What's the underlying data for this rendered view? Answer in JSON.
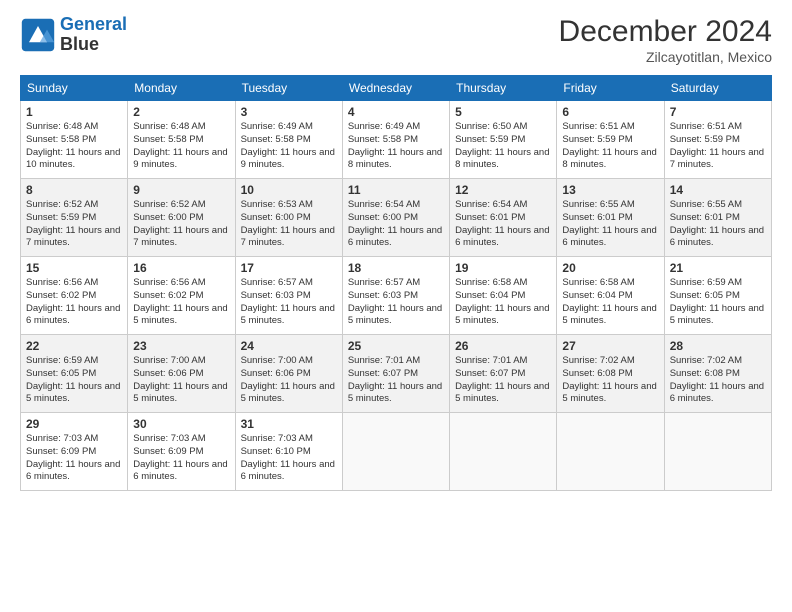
{
  "header": {
    "logo_line1": "General",
    "logo_line2": "Blue",
    "title": "December 2024",
    "subtitle": "Zilcayotitlan, Mexico"
  },
  "weekdays": [
    "Sunday",
    "Monday",
    "Tuesday",
    "Wednesday",
    "Thursday",
    "Friday",
    "Saturday"
  ],
  "weeks": [
    [
      {
        "day": "1",
        "sunrise": "6:48 AM",
        "sunset": "5:58 PM",
        "daylight": "11 hours and 10 minutes."
      },
      {
        "day": "2",
        "sunrise": "6:48 AM",
        "sunset": "5:58 PM",
        "daylight": "11 hours and 9 minutes."
      },
      {
        "day": "3",
        "sunrise": "6:49 AM",
        "sunset": "5:58 PM",
        "daylight": "11 hours and 9 minutes."
      },
      {
        "day": "4",
        "sunrise": "6:49 AM",
        "sunset": "5:58 PM",
        "daylight": "11 hours and 8 minutes."
      },
      {
        "day": "5",
        "sunrise": "6:50 AM",
        "sunset": "5:59 PM",
        "daylight": "11 hours and 8 minutes."
      },
      {
        "day": "6",
        "sunrise": "6:51 AM",
        "sunset": "5:59 PM",
        "daylight": "11 hours and 8 minutes."
      },
      {
        "day": "7",
        "sunrise": "6:51 AM",
        "sunset": "5:59 PM",
        "daylight": "11 hours and 7 minutes."
      }
    ],
    [
      {
        "day": "8",
        "sunrise": "6:52 AM",
        "sunset": "5:59 PM",
        "daylight": "11 hours and 7 minutes."
      },
      {
        "day": "9",
        "sunrise": "6:52 AM",
        "sunset": "6:00 PM",
        "daylight": "11 hours and 7 minutes."
      },
      {
        "day": "10",
        "sunrise": "6:53 AM",
        "sunset": "6:00 PM",
        "daylight": "11 hours and 7 minutes."
      },
      {
        "day": "11",
        "sunrise": "6:54 AM",
        "sunset": "6:00 PM",
        "daylight": "11 hours and 6 minutes."
      },
      {
        "day": "12",
        "sunrise": "6:54 AM",
        "sunset": "6:01 PM",
        "daylight": "11 hours and 6 minutes."
      },
      {
        "day": "13",
        "sunrise": "6:55 AM",
        "sunset": "6:01 PM",
        "daylight": "11 hours and 6 minutes."
      },
      {
        "day": "14",
        "sunrise": "6:55 AM",
        "sunset": "6:01 PM",
        "daylight": "11 hours and 6 minutes."
      }
    ],
    [
      {
        "day": "15",
        "sunrise": "6:56 AM",
        "sunset": "6:02 PM",
        "daylight": "11 hours and 6 minutes."
      },
      {
        "day": "16",
        "sunrise": "6:56 AM",
        "sunset": "6:02 PM",
        "daylight": "11 hours and 5 minutes."
      },
      {
        "day": "17",
        "sunrise": "6:57 AM",
        "sunset": "6:03 PM",
        "daylight": "11 hours and 5 minutes."
      },
      {
        "day": "18",
        "sunrise": "6:57 AM",
        "sunset": "6:03 PM",
        "daylight": "11 hours and 5 minutes."
      },
      {
        "day": "19",
        "sunrise": "6:58 AM",
        "sunset": "6:04 PM",
        "daylight": "11 hours and 5 minutes."
      },
      {
        "day": "20",
        "sunrise": "6:58 AM",
        "sunset": "6:04 PM",
        "daylight": "11 hours and 5 minutes."
      },
      {
        "day": "21",
        "sunrise": "6:59 AM",
        "sunset": "6:05 PM",
        "daylight": "11 hours and 5 minutes."
      }
    ],
    [
      {
        "day": "22",
        "sunrise": "6:59 AM",
        "sunset": "6:05 PM",
        "daylight": "11 hours and 5 minutes."
      },
      {
        "day": "23",
        "sunrise": "7:00 AM",
        "sunset": "6:06 PM",
        "daylight": "11 hours and 5 minutes."
      },
      {
        "day": "24",
        "sunrise": "7:00 AM",
        "sunset": "6:06 PM",
        "daylight": "11 hours and 5 minutes."
      },
      {
        "day": "25",
        "sunrise": "7:01 AM",
        "sunset": "6:07 PM",
        "daylight": "11 hours and 5 minutes."
      },
      {
        "day": "26",
        "sunrise": "7:01 AM",
        "sunset": "6:07 PM",
        "daylight": "11 hours and 5 minutes."
      },
      {
        "day": "27",
        "sunrise": "7:02 AM",
        "sunset": "6:08 PM",
        "daylight": "11 hours and 5 minutes."
      },
      {
        "day": "28",
        "sunrise": "7:02 AM",
        "sunset": "6:08 PM",
        "daylight": "11 hours and 6 minutes."
      }
    ],
    [
      {
        "day": "29",
        "sunrise": "7:03 AM",
        "sunset": "6:09 PM",
        "daylight": "11 hours and 6 minutes."
      },
      {
        "day": "30",
        "sunrise": "7:03 AM",
        "sunset": "6:09 PM",
        "daylight": "11 hours and 6 minutes."
      },
      {
        "day": "31",
        "sunrise": "7:03 AM",
        "sunset": "6:10 PM",
        "daylight": "11 hours and 6 minutes."
      },
      null,
      null,
      null,
      null
    ]
  ]
}
